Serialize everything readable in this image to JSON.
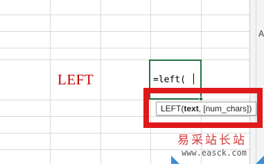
{
  "sheet": {
    "cell_label": "LEFT",
    "active_cell_formula": "=left("
  },
  "tooltip": {
    "func_prefix": "LEFT(",
    "arg_bold": "text",
    "arg_rest": ", [num_chars])"
  },
  "right_panel": {
    "glyph": "A"
  },
  "watermark": {
    "chinese": "易采站长站",
    "url": "www.easck.com"
  },
  "colors": {
    "grid": "#d9d9d9",
    "active_border": "#217346",
    "highlight_red": "#e01a1a",
    "label_red": "#c00000"
  }
}
